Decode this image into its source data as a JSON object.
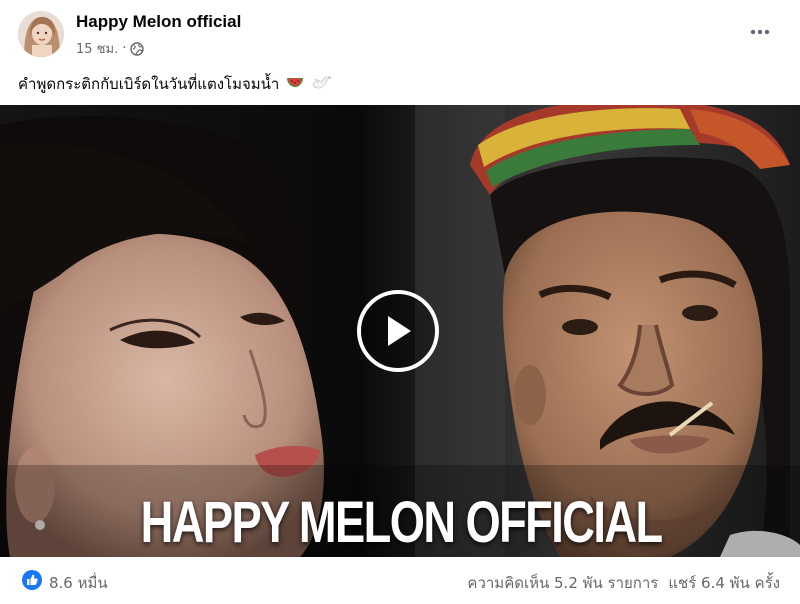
{
  "post": {
    "page_name": "Happy Melon official",
    "timestamp": "15 ชม.",
    "separator": "·",
    "audience_icon": "globe-icon",
    "more_icon": "more-options-icon",
    "caption": "คำพูดกระติกกับเบิร์ดในวันที่แตงโมจมน้ำ",
    "caption_emojis": [
      "watermelon-icon",
      "dove-icon"
    ]
  },
  "video": {
    "overlay_title": "HAPPY MELON OFFICIAL",
    "play_icon": "play-icon"
  },
  "footer": {
    "reaction_icon": "like-icon",
    "reaction_count": "8.6 หมื่น",
    "comments": "ความคิดเห็น 5.2 พัน รายการ",
    "shares": "แชร์ 6.4 พัน ครั้ง"
  },
  "colors": {
    "text_primary": "#050505",
    "text_secondary": "#65676b",
    "like_blue": "#1877f2",
    "background": "#ffffff"
  }
}
